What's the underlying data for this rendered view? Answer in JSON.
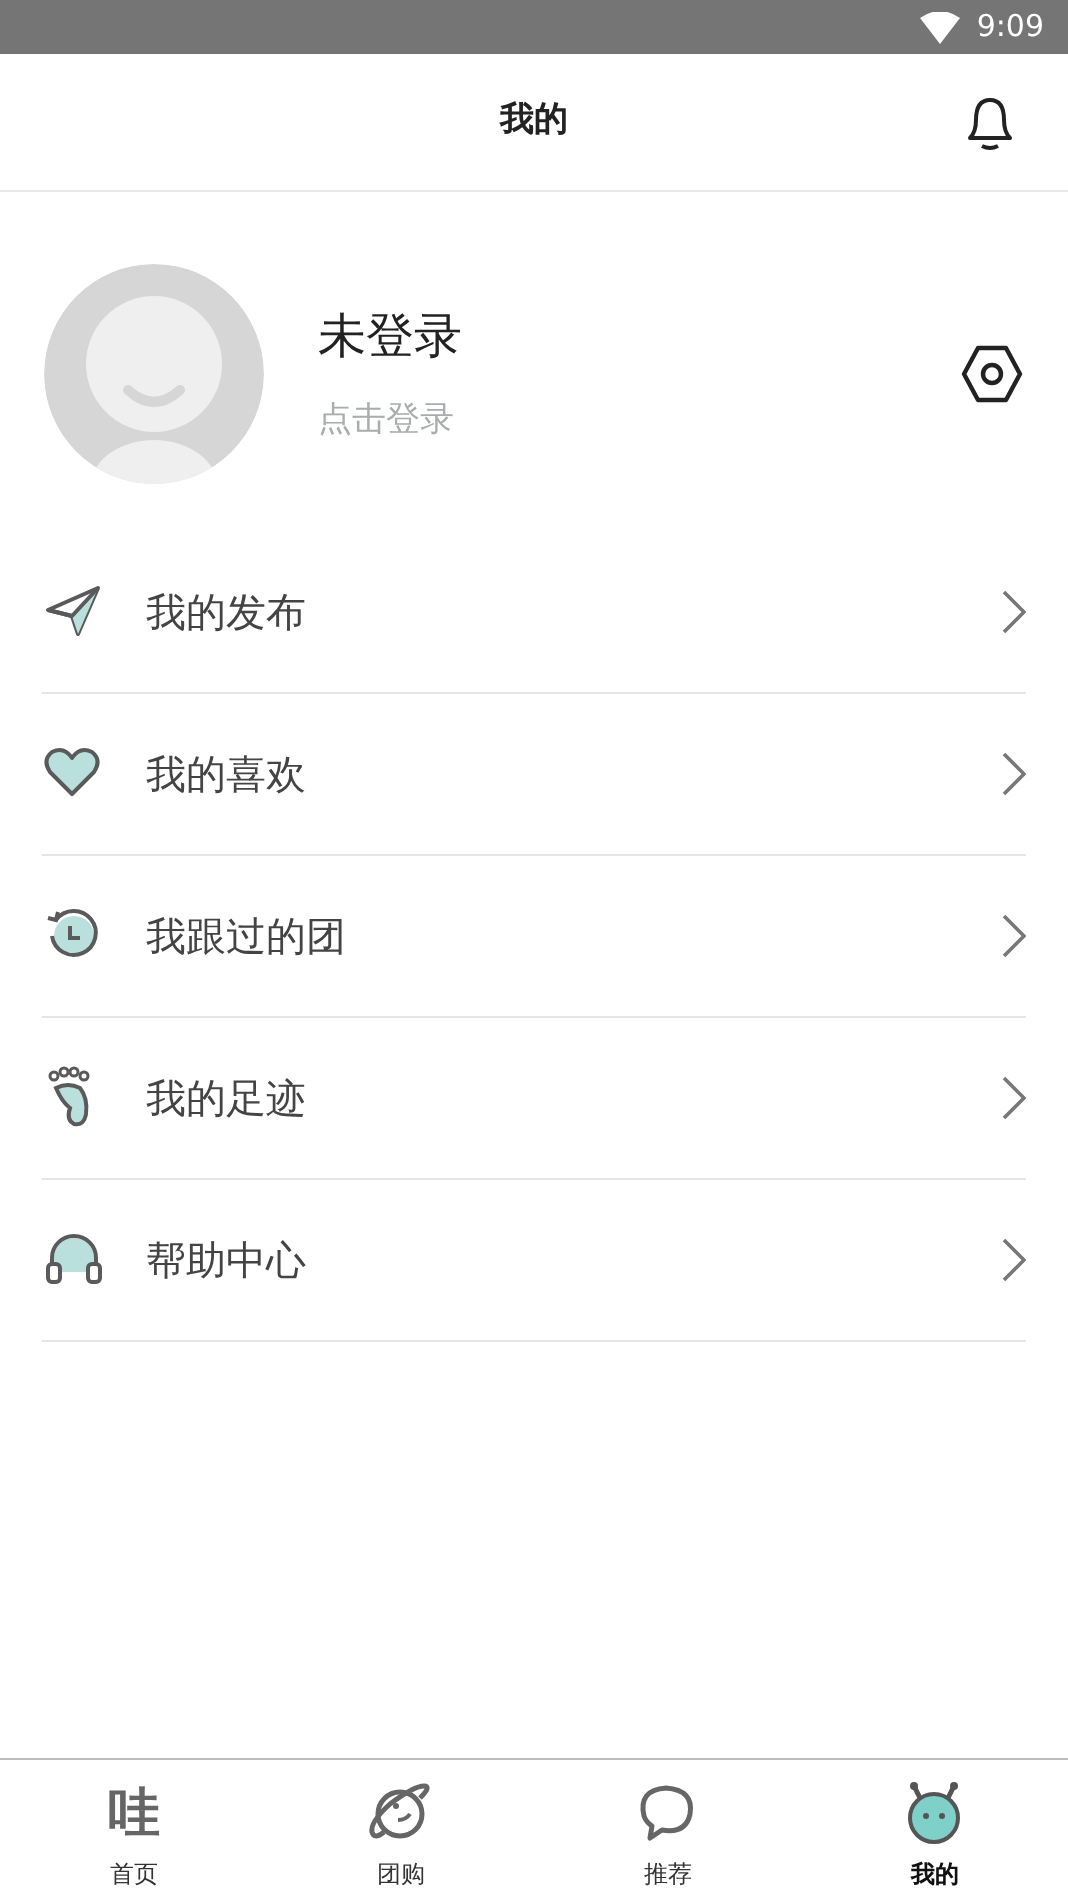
{
  "status_bar": {
    "time": "9:09"
  },
  "header": {
    "title": "我的"
  },
  "profile": {
    "name": "未登录",
    "subtitle": "点击登录"
  },
  "menu": [
    {
      "label": "我的发布"
    },
    {
      "label": "我的喜欢"
    },
    {
      "label": "我跟过的团"
    },
    {
      "label": "我的足迹"
    },
    {
      "label": "帮助中心"
    }
  ],
  "bottom_nav": [
    {
      "label": "首页",
      "icon_text": "哇",
      "selected": false
    },
    {
      "label": "团购",
      "selected": false
    },
    {
      "label": "推荐",
      "selected": false
    },
    {
      "label": "我的",
      "selected": true
    }
  ]
}
